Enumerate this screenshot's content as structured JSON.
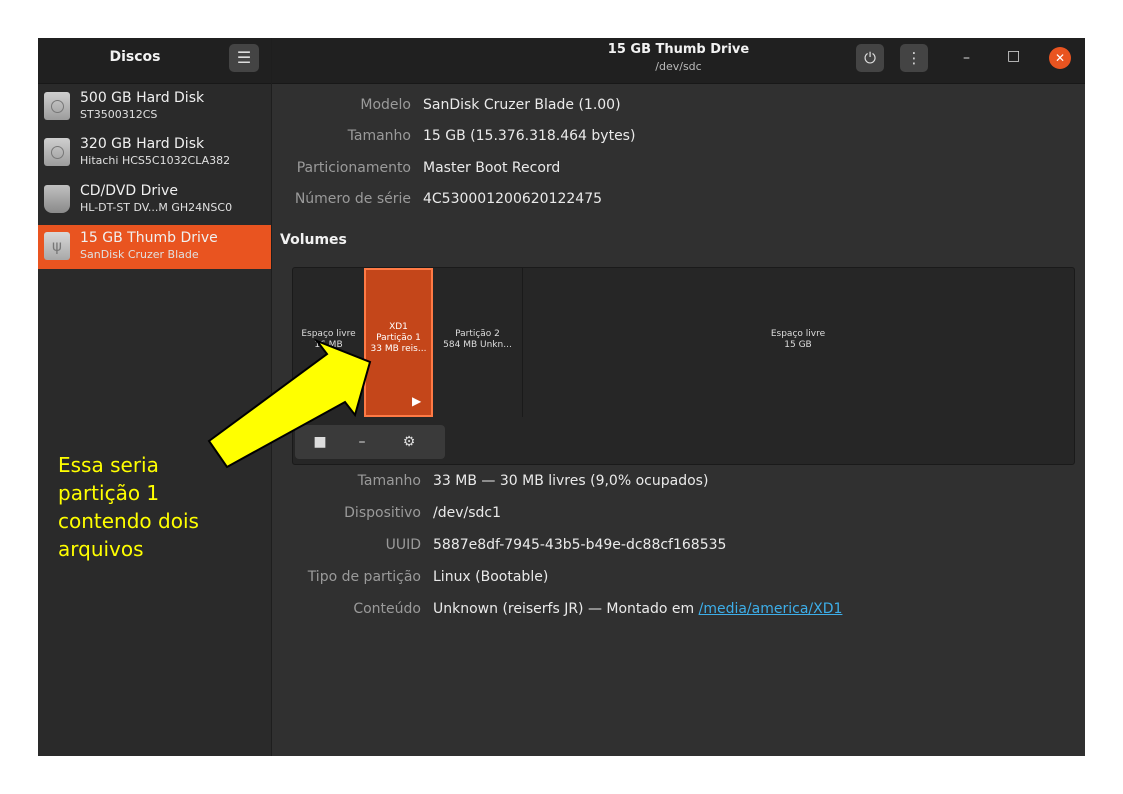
{
  "sidebar": {
    "title": "Discos",
    "menu_icon": "hamburger-icon",
    "drives": [
      {
        "name": "500 GB Hard Disk",
        "model": "ST3500312CS",
        "icon": "hard-disk-icon"
      },
      {
        "name": "320 GB Hard Disk",
        "model": "Hitachi HCS5C1032CLA382",
        "icon": "hard-disk-icon"
      },
      {
        "name": "CD/DVD Drive",
        "model": "HL-DT-ST DV...M GH24NSC0",
        "icon": "optical-drive-icon"
      },
      {
        "name": "15 GB Thumb Drive",
        "model": "SanDisk Cruzer Blade",
        "icon": "usb-icon"
      }
    ]
  },
  "header": {
    "title": "15 GB Thumb Drive",
    "subtitle": "/dev/sdc",
    "accent": "#e95420"
  },
  "drive_info": {
    "model_label": "Modelo",
    "model": "SanDisk Cruzer Blade (1.00)",
    "size_label": "Tamanho",
    "size": "15 GB (15.376.318.464 bytes)",
    "partitioning_label": "Particionamento",
    "partitioning": "Master Boot Record",
    "serial_label": "Número de série",
    "serial": "4C530001200620122475"
  },
  "volumes": {
    "title": "Volumes",
    "segments": [
      {
        "line1": "Espaço livre",
        "line2": "16 MB"
      },
      {
        "line1": "XD1",
        "line2": "Partição 1",
        "line3": "33 MB reis..."
      },
      {
        "line1": "Partição 2",
        "line2": "584 MB Unkn..."
      },
      {
        "line1": "Espaço livre",
        "line2": "15 GB"
      }
    ]
  },
  "partition": {
    "size_label": "Tamanho",
    "size": "33 MB — 30 MB livres (9,0% ocupados)",
    "device_label": "Dispositivo",
    "device": "/dev/sdc1",
    "uuid_label": "UUID",
    "uuid": "5887e8df-7945-43b5-b49e-dc88cf168535",
    "type_label": "Tipo de partição",
    "type": "Linux (Bootable)",
    "content_label": "Conteúdo",
    "content": "Unknown (reiserfs JR) — Montado em ",
    "mount_link": "/media/america/XD1"
  },
  "annotation": {
    "text": "Essa seria\npartição 1\ncontendo dois\narquivos",
    "color": "#ffff00"
  }
}
